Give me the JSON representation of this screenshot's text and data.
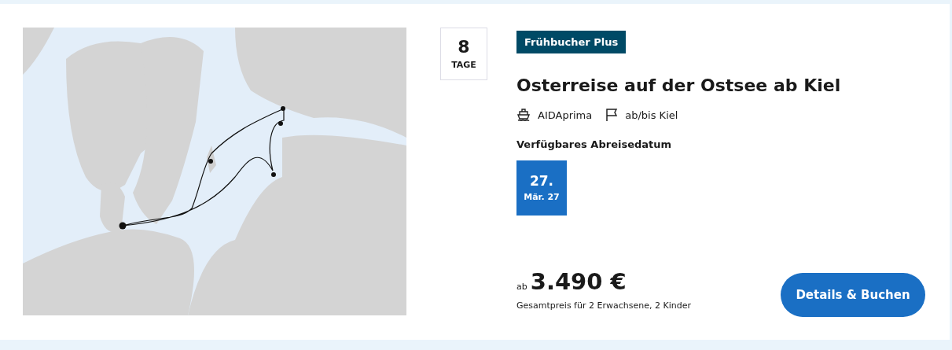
{
  "duration": {
    "number": "8",
    "unit": "TAGE"
  },
  "badge": "Frühbucher Plus",
  "title": "Osterreise auf der Ostsee ab Kiel",
  "details": {
    "ship": "AIDAprima",
    "port": "ab/bis Kiel"
  },
  "dates_heading": "Verfügbares Abreisedatum",
  "dates": [
    {
      "day": "27.",
      "month": "Mär. 27"
    }
  ],
  "price": {
    "prefix": "ab",
    "amount": "3.490 €",
    "note": "Gesamtpreis für 2 Erwachsene, 2 Kinder"
  },
  "button": "Details & Buchen"
}
